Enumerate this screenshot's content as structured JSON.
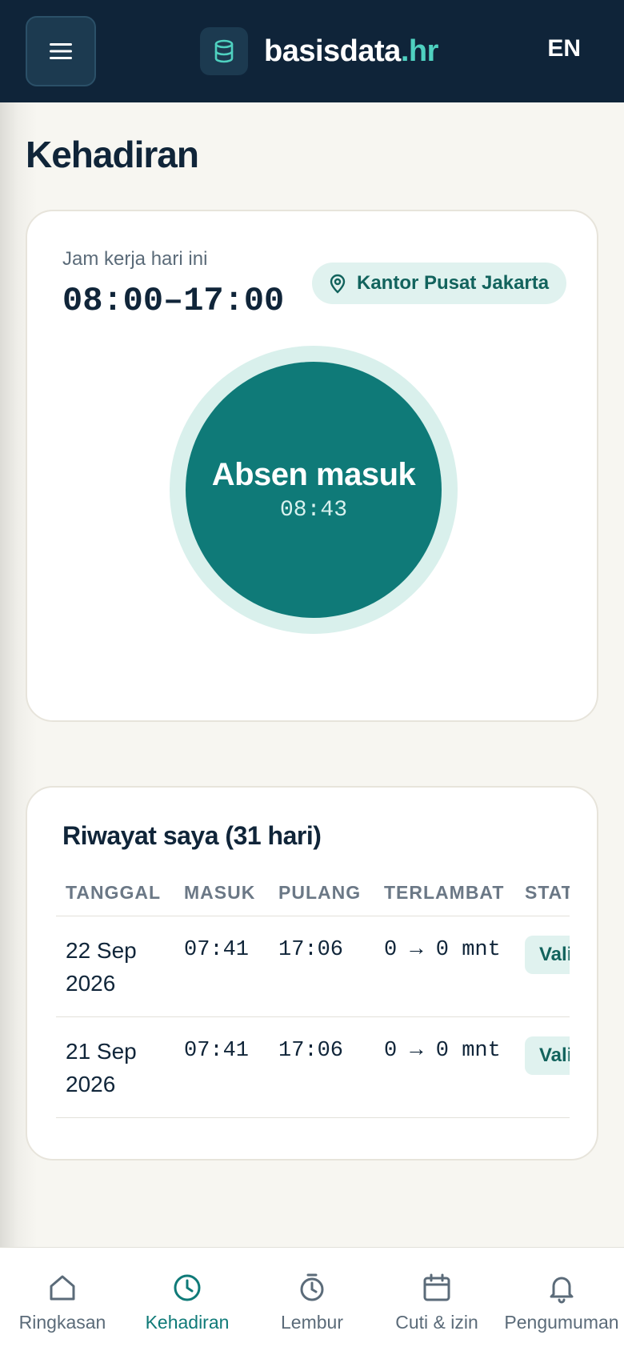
{
  "header": {
    "menu_icon": "hamburger-icon",
    "logo_icon": "database-icon",
    "brand_main": "basisdata",
    "brand_accent": ".hr",
    "language": "EN"
  },
  "page": {
    "title": "Kehadiran"
  },
  "attendance": {
    "work_label": "Jam kerja hari ini",
    "work_hours": "08:00–17:00",
    "location_icon": "map-pin-icon",
    "location": "Kantor Pusat Jakarta",
    "clock_label": "Absen masuk",
    "clock_time": "08:43"
  },
  "history": {
    "title": "Riwayat saya (31 hari)",
    "columns": [
      "TANGGAL",
      "MASUK",
      "PULANG",
      "TERLAMBAT",
      "STATUS"
    ],
    "rows": [
      {
        "date": "22 Sep 2026",
        "in": "07:41",
        "out": "17:06",
        "late": "0 → 0 mnt",
        "status": "Valid"
      },
      {
        "date": "21 Sep 2026",
        "in": "07:41",
        "out": "17:06",
        "late": "0 → 0 mnt",
        "status": "Valid"
      }
    ]
  },
  "nav": {
    "items": [
      {
        "label": "Ringkasan",
        "icon": "home-icon"
      },
      {
        "label": "Kehadiran",
        "icon": "clock-icon",
        "active": true
      },
      {
        "label": "Lembur",
        "icon": "stopwatch-icon"
      },
      {
        "label": "Cuti & izin",
        "icon": "calendar-icon"
      },
      {
        "label": "Pengumuman",
        "icon": "bell-icon"
      }
    ]
  },
  "colors": {
    "header_bg": "#0f2439",
    "accent": "#0f7a78",
    "accent_light": "#d9f0ec",
    "brand_accent": "#4fd1c0"
  }
}
